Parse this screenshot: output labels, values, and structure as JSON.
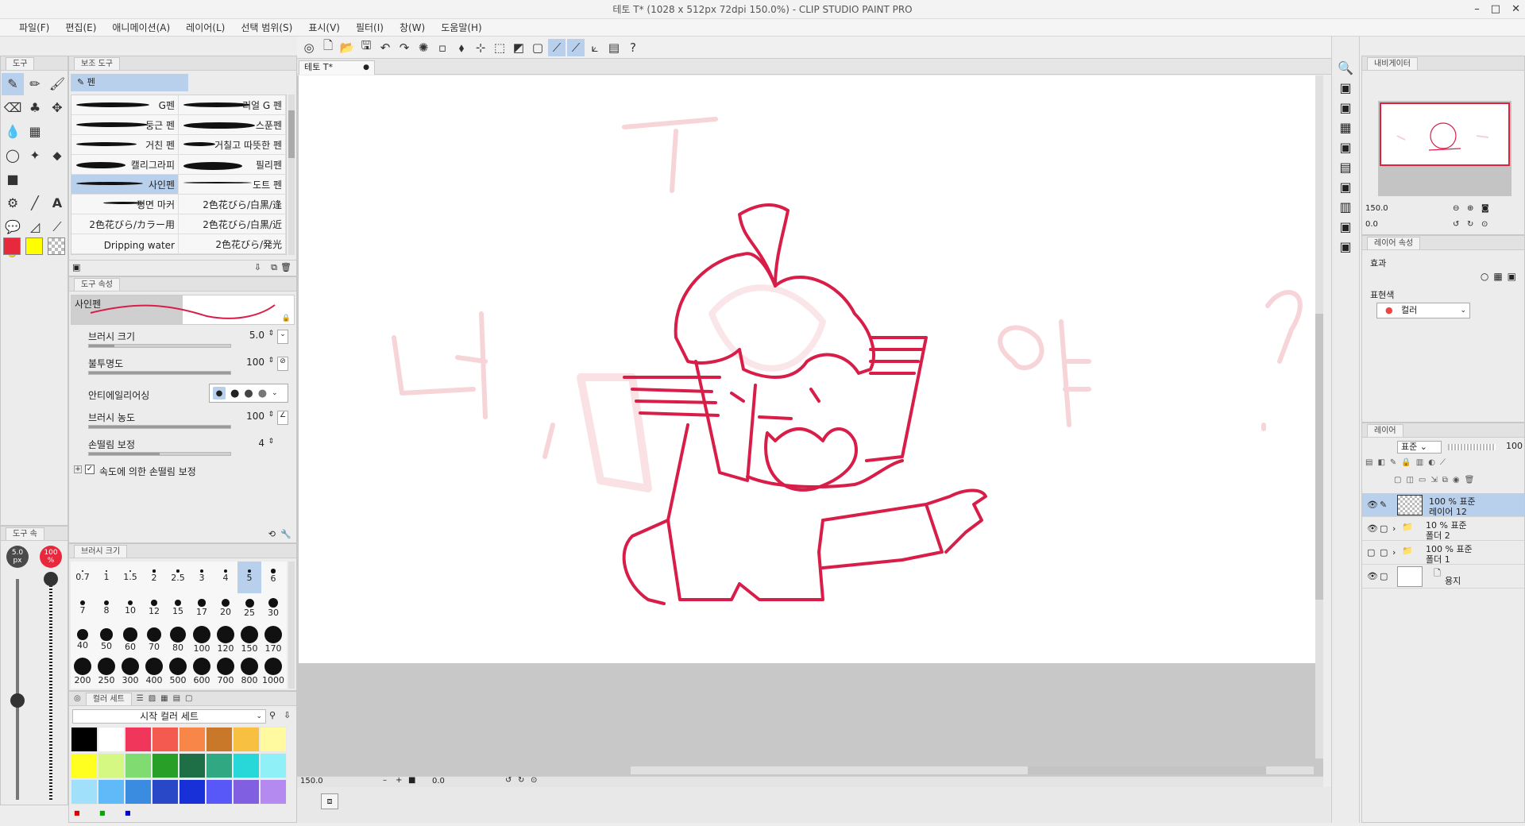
{
  "window": {
    "title": "테토 T* (1028 x 512px 72dpi 150.0%) - CLIP STUDIO PAINT PRO",
    "controls": [
      "–",
      "□",
      "✕"
    ]
  },
  "menu": [
    "파일(F)",
    "편집(E)",
    "애니메이션(A)",
    "레이어(L)",
    "선택 범위(S)",
    "표시(V)",
    "필터(I)",
    "창(W)",
    "도움말(H)"
  ],
  "tool_panel": {
    "tab": "도구"
  },
  "subtool_panel": {
    "tab": "보조 도구",
    "group": "펜",
    "rows": [
      {
        "left": "G펜",
        "right": "리얼 G 펜"
      },
      {
        "left": "둥근 펜",
        "right": "스푼펜"
      },
      {
        "left": "거친 펜",
        "right": "거칠고 따뜻한 펜"
      },
      {
        "left": "캘리그라피",
        "right": "필리펜"
      },
      {
        "left": "사인펜",
        "right": "도트 펜"
      },
      {
        "left": "평면 마커",
        "right": "2色花びら/白黒/逢"
      },
      {
        "left": "2色花びら/カラー用",
        "right": "2色花びら/白黒/近"
      },
      {
        "left": "Dripping water",
        "right": "2色花びら/発光"
      }
    ]
  },
  "tool_property": {
    "tab": "도구 속성",
    "name": "사인펜",
    "brush_size_label": "브러시 크기",
    "brush_size_value": "5.0",
    "brush_size_fraction": 0.18,
    "opacity_label": "불투명도",
    "opacity_value": "100",
    "opacity_fraction": 1.0,
    "antialias_label": "안티에일리어싱",
    "density_label": "브러시 농도",
    "density_value": "100",
    "density_fraction": 1.0,
    "stabilization_label": "손떨림 보정",
    "stabilization_value": "4",
    "stabilization_fraction": 0.5,
    "speed_label": "속도에 의한 손떨림 보정"
  },
  "mini_tool": {
    "tab": "도구 속",
    "size_badge": "5.0 px",
    "opacity_badge": "100 %",
    "size_slider_fraction": 0.45,
    "opacity_slider_fraction": 1.0
  },
  "brush_size_panel": {
    "tab": "브러시 크기",
    "sizes": [
      "0.7",
      "1",
      "1.5",
      "2",
      "2.5",
      "3",
      "4",
      "5",
      "6",
      "7",
      "8",
      "10",
      "12",
      "15",
      "17",
      "20",
      "25",
      "30",
      "40",
      "50",
      "60",
      "70",
      "80",
      "100",
      "120",
      "150",
      "170",
      "200",
      "250",
      "300",
      "400",
      "500",
      "600",
      "700",
      "800",
      "1000"
    ],
    "selected": "5"
  },
  "color_set": {
    "tab": "컬러 세트",
    "set_name": "시작 컬러 세트",
    "swatches": [
      "#000000",
      "#ffffff",
      "#f0365a",
      "#f45a50",
      "#f88648",
      "#c87828",
      "#f8c040",
      "#fffaa0",
      "#ffff20",
      "#d4f882",
      "#80dc70",
      "#28a028",
      "#1e6e46",
      "#30a882",
      "#28d8d8",
      "#90f0f8",
      "#a0e0fa",
      "#60baf8",
      "#3a8ce0",
      "#2848c8",
      "#1830d8",
      "#5858f8",
      "#8060e0",
      "#b48af0"
    ],
    "mini_icons": [
      "■",
      "■",
      "■"
    ]
  },
  "canvas": {
    "tab": "테토 T*",
    "zoom": "150.0",
    "angle": "0.0",
    "text_strokes": [
      "너,",
      "?",
      "야",
      "T"
    ]
  },
  "navigator": {
    "tab": "내비게이터",
    "zoom": "150.0",
    "angle": "0.0"
  },
  "layer_property": {
    "tab": "레이어 속성",
    "effect_label": "효과",
    "expression_label": "표현색",
    "expression_value": "컬러"
  },
  "layers_panel": {
    "tab": "레이어",
    "blend": "표준",
    "opacity": "100",
    "layers": [
      {
        "top": "100 % 표준",
        "name": "레이어 12",
        "selected": true
      },
      {
        "top": "10 % 표준",
        "name": "폴더 2",
        "selected": false
      },
      {
        "top": "100 % 표준",
        "name": "폴더 1",
        "selected": false
      },
      {
        "top": "",
        "name": "용지",
        "selected": false
      }
    ]
  },
  "colors": {
    "accent": "#b8d0ec",
    "main_color": "#e8283c",
    "sub_color": "#ffff00",
    "ink": "#d81e48"
  }
}
